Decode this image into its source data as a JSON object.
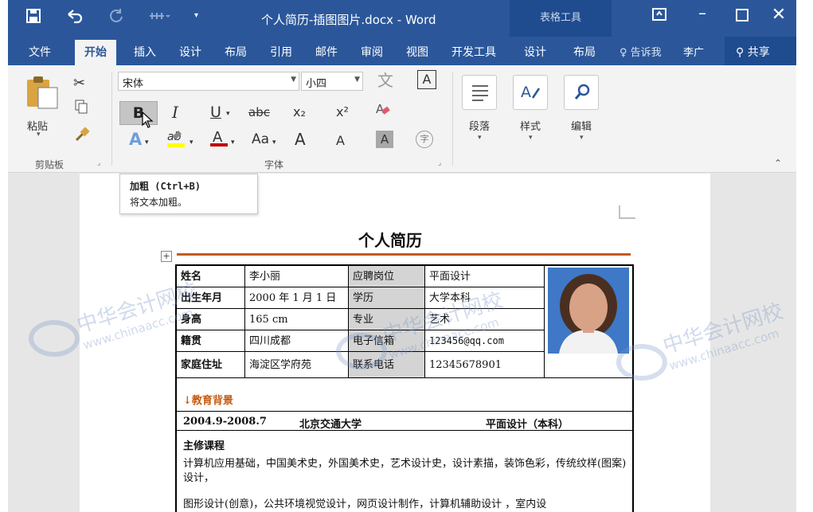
{
  "window": {
    "title": "个人简历-插图图片.docx - Word",
    "context_tab": "表格工具"
  },
  "tabs": [
    "文件",
    "开始",
    "插入",
    "设计",
    "布局",
    "引用",
    "邮件",
    "审阅",
    "视图",
    "开发工具",
    "设计",
    "布局"
  ],
  "tell_me": "告诉我",
  "user": "李广",
  "share": "共享",
  "ribbon": {
    "clipboard": {
      "paste": "粘贴",
      "label": "剪贴板"
    },
    "font": {
      "name": "宋体",
      "size": "小四",
      "label": "字体",
      "bold": "B",
      "italic": "I",
      "underline": "U",
      "strike": "abc",
      "subscript": "x₂",
      "superscript": "x²",
      "case": "Aa",
      "grow": "A",
      "shrink": "A",
      "text_fx": "A",
      "shade": "A",
      "enclose": "字",
      "font_color_hex": "#c00000",
      "highlight_hex": "#ffff00",
      "phonetic": "文"
    },
    "paragraph": "段落",
    "styles": "样式",
    "editing": "编辑"
  },
  "tooltip": {
    "title": "加粗 (Ctrl+B)",
    "desc": "将文本加粗。"
  },
  "resume": {
    "title": "个人简历",
    "rows": [
      {
        "l1": "姓名",
        "v1": "李小丽",
        "l2": "应聘岗位",
        "v2": "平面设计"
      },
      {
        "l1": "出生年月",
        "v1": "2000 年 1 月 1 日",
        "l2": "学历",
        "v2": "大学本科"
      },
      {
        "l1": "身高",
        "v1": "165 cm",
        "l2": "专业",
        "v2": "艺术"
      },
      {
        "l1": "籍贯",
        "v1": "四川成都",
        "l2": "电子信箱",
        "v2": "123456@qq.com"
      },
      {
        "l1": "家庭住址",
        "v1": "海淀区学府苑",
        "l2": "联系电话",
        "v2": "12345678901"
      }
    ],
    "edu_head": "↓教育背景",
    "edu_period": "2004.9-2008.7",
    "edu_school": "北京交通大学",
    "edu_major": "平面设计（本科）",
    "courses_head": "主修课程",
    "courses": "计算机应用基础，中国美术史，外国美术史，艺术设计史，设计素描，装饰色彩，传统纹样(图案)设计，",
    "courses2": "图形设计(创意)，公共环境视觉设计，网页设计制作，计算机辅助设计 ，室内设"
  },
  "watermarks": {
    "cn": "中华会计网校",
    "url": "www.chinaacc.com"
  },
  "colors": {
    "word_blue": "#2b579a",
    "accent_orange": "#c55a11"
  }
}
